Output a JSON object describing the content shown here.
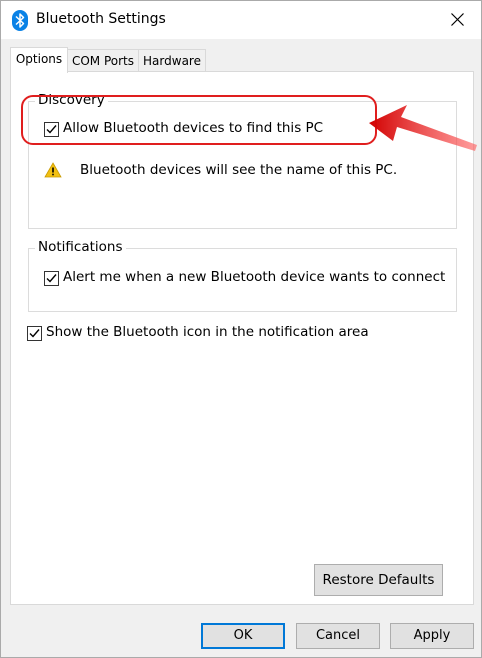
{
  "window": {
    "title": "Bluetooth Settings"
  },
  "tabs": [
    {
      "label": "Options",
      "active": true
    },
    {
      "label": "COM Ports",
      "active": false
    },
    {
      "label": "Hardware",
      "active": false
    }
  ],
  "discovery": {
    "legend": "Discovery",
    "allow_label": "Allow Bluetooth devices to find this PC",
    "allow_checked": true,
    "warning_text": "Bluetooth devices will see the name of this PC."
  },
  "notifications": {
    "legend": "Notifications",
    "alert_label": "Alert me when a new Bluetooth device wants to connect",
    "alert_checked": true
  },
  "show_icon": {
    "label": "Show the Bluetooth icon in the notification area",
    "checked": true
  },
  "buttons": {
    "restore": "Restore Defaults",
    "ok": "OK",
    "cancel": "Cancel",
    "apply": "Apply"
  },
  "icons": {
    "title_icon": "bluetooth-icon",
    "warning_icon": "warning-icon",
    "close_icon": "close-icon",
    "annotation_arrow": "red-arrow"
  },
  "colors": {
    "bluetooth_blue": "#0a82e6",
    "annotation_red": "#e01e1e",
    "default_button_border": "#0078d7",
    "warning_yellow": "#f2c012"
  }
}
